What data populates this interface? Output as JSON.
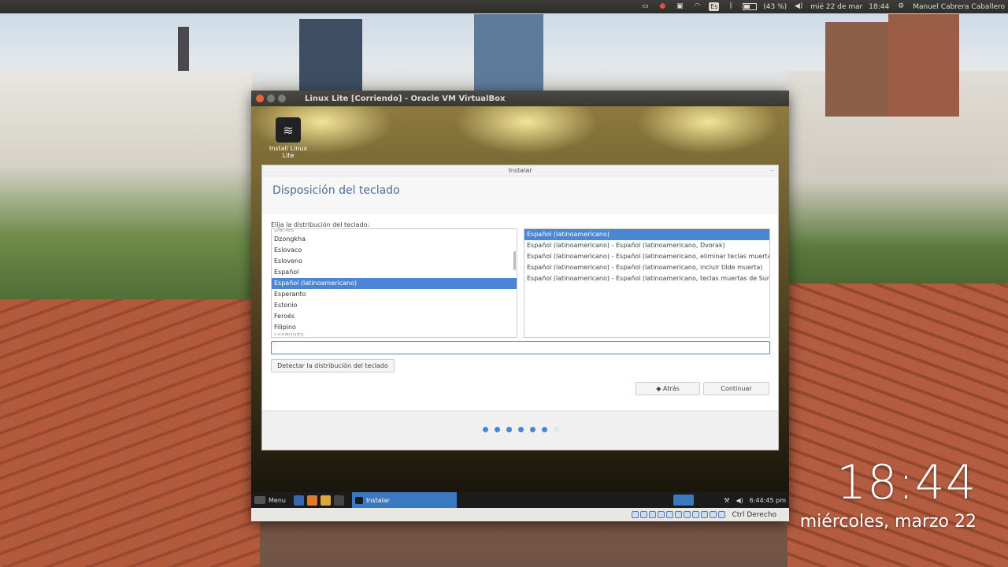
{
  "top_panel": {
    "battery": "(43 %)",
    "date": "mié 22 de mar",
    "time": "18:44",
    "user": "Manuel Cabrera Caballero",
    "keyboard_layout": "Es"
  },
  "desktop_clock": {
    "time": "18:44",
    "date": "miércoles, marzo 22"
  },
  "vbox_window": {
    "title": "Linux Lite [Corriendo] - Oracle VM VirtualBox",
    "host_key": "Ctrl Derecho"
  },
  "guest_desktop": {
    "icon_label": "Install Linux Lite"
  },
  "installer": {
    "window_title": "Instalar",
    "heading": "Disposición del teclado",
    "prompt": "Elija la distribución del teclado:",
    "layouts": [
      "Dzongkha",
      "Eslovaco",
      "Esloveno",
      "Español",
      "Español (latinoamericano)",
      "Esperanto",
      "Estonio",
      "Feroés",
      "Filipino"
    ],
    "layout_cut_top": "Danés",
    "layout_cut_bottom": "Finlandés",
    "variants": [
      "Español (latinoamericano)",
      "Español (latinoamericano) - Español (latinoamericano, Dvorak)",
      "Español (latinoamericano) - Español (latinoamericano, eliminar teclas muertas)",
      "Español (latinoamericano) - Español (latinoamericano, incluir tilde muerta)",
      "Español (latinoamericano) - Español (latinoamericano, teclas muertas de Sun)"
    ],
    "detect_button": "Detectar la distribución del teclado",
    "back_button": "◆ Atrás",
    "continue_button": "Continuar",
    "progress_step": 6,
    "progress_total": 7
  },
  "guest_taskbar": {
    "menu_label": "Menu",
    "task_label": "Instalar",
    "clock": "6:44:45 pm"
  }
}
